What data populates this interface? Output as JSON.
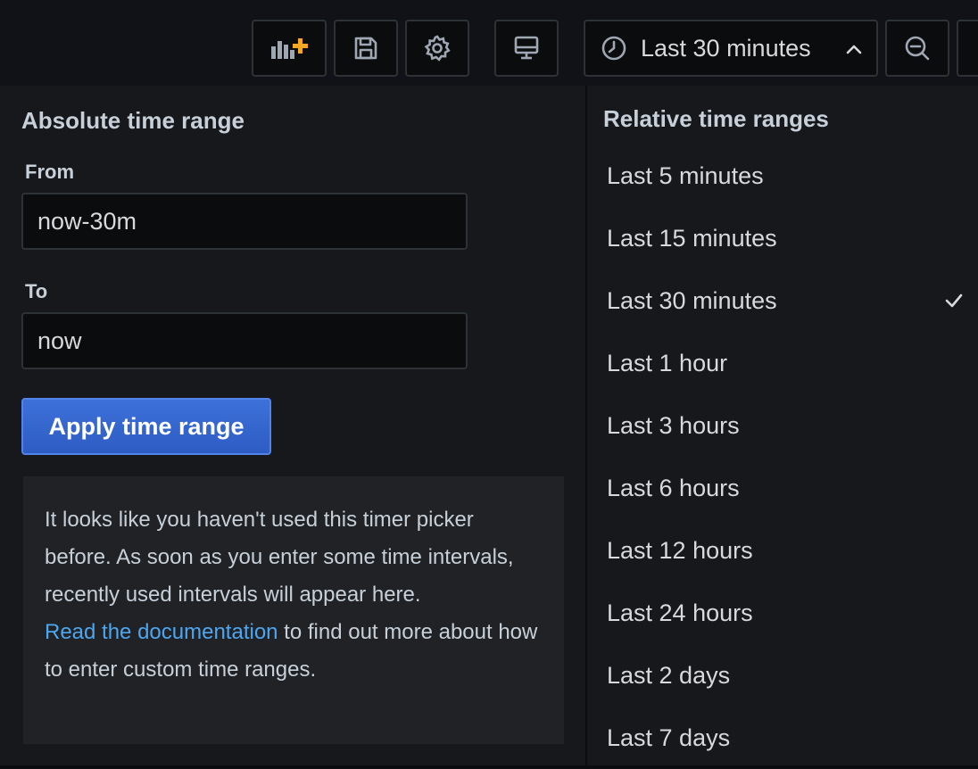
{
  "toolbar": {
    "time_picker_label": "Last 30 minutes",
    "icons": [
      "add-panel-icon",
      "save-icon",
      "gear-icon",
      "tv-mode-icon",
      "clock-icon",
      "chevron-up-icon",
      "zoom-out-icon"
    ],
    "accent_color": "#f5a623"
  },
  "absolute": {
    "title": "Absolute time range",
    "from_label": "From",
    "from_value": "now-30m",
    "to_label": "To",
    "to_value": "now",
    "apply_label": "Apply time range",
    "apply_color": "#3d71d9"
  },
  "help": {
    "text": "It looks like you haven't used this timer picker before. As soon as you enter some time intervals, recently used intervals will appear here.",
    "link_text": "Read the documentation",
    "link_suffix": " to find out more about how to enter custom time ranges.",
    "link_color": "#4da6f0"
  },
  "relative": {
    "title": "Relative time ranges",
    "selected": "Last 30 minutes",
    "items": [
      "Last 5 minutes",
      "Last 15 minutes",
      "Last 30 minutes",
      "Last 1 hour",
      "Last 3 hours",
      "Last 6 hours",
      "Last 12 hours",
      "Last 24 hours",
      "Last 2 days",
      "Last 7 days"
    ]
  }
}
